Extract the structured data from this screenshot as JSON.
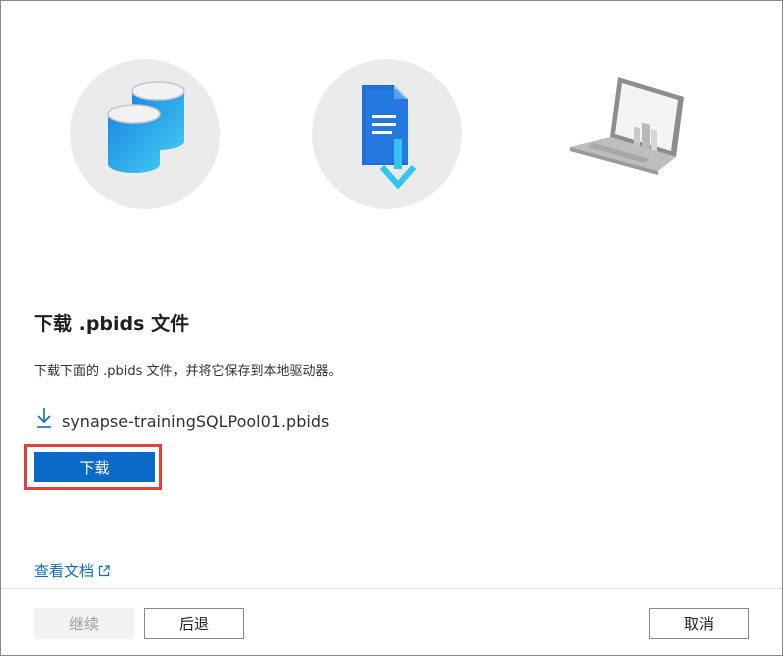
{
  "dialog": {
    "heading": "下载 .pbids 文件",
    "description": "下载下面的 .pbids 文件，并将它保存到本地驱动器。",
    "file_name": "synapse-trainingSQLPool01.pbids",
    "download_label": "下载",
    "doc_link_label": "查看文档"
  },
  "footer": {
    "continue_label": "继续",
    "back_label": "后退",
    "cancel_label": "取消"
  },
  "illustrations": [
    {
      "icon": "database-icon"
    },
    {
      "icon": "file-download-icon"
    },
    {
      "icon": "laptop-icon"
    }
  ],
  "colors": {
    "accent": "#0b6ac7",
    "highlight_border": "#e0403e",
    "link": "#0f6cbd",
    "disabled_bg": "#f3f2f1"
  }
}
